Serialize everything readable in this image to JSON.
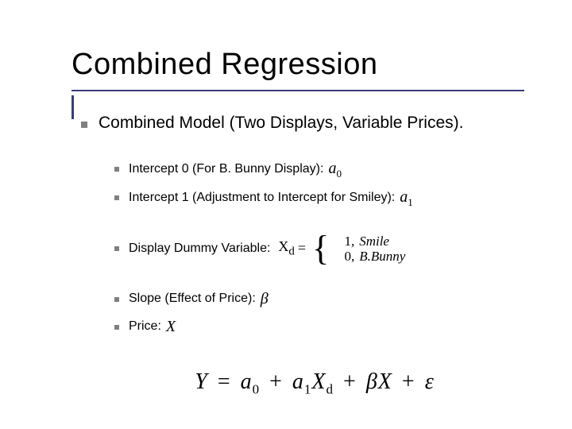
{
  "title": "Combined Regression",
  "main_point": "Combined Model (Two Displays, Variable Prices).",
  "groups": [
    {
      "items": [
        {
          "label": "Intercept 0 (For B. Bunny Display):",
          "sym_html": "a<sub class='sub'>0</sub>"
        },
        {
          "label": "Intercept 1 (Adjustment to Intercept for Smiley):",
          "sym_html": "a<sub class='sub'>1</sub>"
        }
      ]
    },
    {
      "items": [
        {
          "label": "Display Dummy Variable:",
          "piecewise": {
            "lhs": "X<sub class='sub'>d</sub>",
            "rows": [
              {
                "val": "1,",
                "cond": "Smile"
              },
              {
                "val": "0,",
                "cond": "B.Bunny"
              }
            ]
          }
        }
      ]
    },
    {
      "items": [
        {
          "label": "Slope (Effect of Price):",
          "sym_html": "β"
        },
        {
          "label": "Price:",
          "sym_html": "X"
        }
      ]
    }
  ],
  "equation_html": "Y <span class='op'>=</span> a<sub class='sub'>0</sub> <span class='op'>+</span> a<sub class='sub'>1</sub>X<sub class='sub'>d</sub> <span class='op'>+</span> βX <span class='op'>+</span> ε"
}
